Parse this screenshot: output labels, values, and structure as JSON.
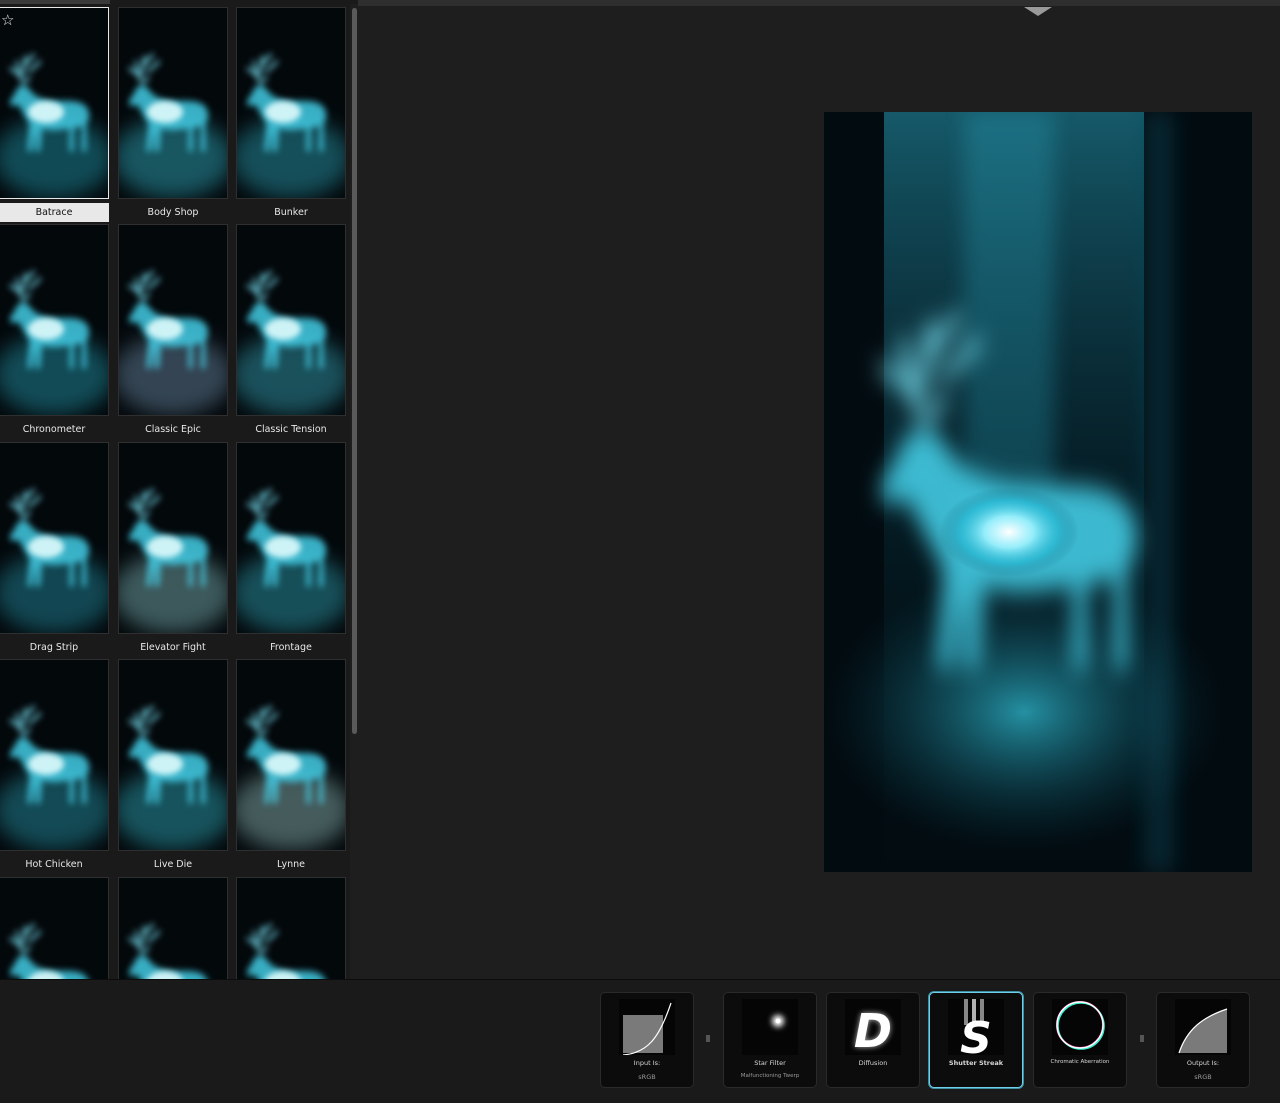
{
  "presets": {
    "favorite_icon": "star-outline-icon",
    "selected": "Batrace",
    "items": [
      {
        "label": "Batrace"
      },
      {
        "label": "Body Shop"
      },
      {
        "label": "Bunker"
      },
      {
        "label": "Chronometer"
      },
      {
        "label": "Classic Epic"
      },
      {
        "label": "Classic Tension"
      },
      {
        "label": "Drag Strip"
      },
      {
        "label": "Elevator Fight"
      },
      {
        "label": "Frontage"
      },
      {
        "label": "Hot Chicken"
      },
      {
        "label": "Live Die"
      },
      {
        "label": "Lynne"
      },
      {
        "label": ""
      },
      {
        "label": ""
      },
      {
        "label": ""
      }
    ]
  },
  "viewer": {
    "collapse_icon": "triangle-down-icon",
    "image_subject": "glowing cyan stag"
  },
  "tool_chain": {
    "input": {
      "title": "Input Is:",
      "value": "sRGB",
      "icon": "curve-icon"
    },
    "tools": [
      {
        "name": "Star Filter",
        "sub": "Malfunctioning Twerp",
        "icon": "star-filter-icon"
      },
      {
        "name": "Diffusion",
        "sub": "",
        "icon": "diffusion-d-icon"
      },
      {
        "name": "Shutter Streak",
        "sub": "",
        "icon": "shutter-streak-s-icon",
        "active": true
      },
      {
        "name": "Chromatic Aberration",
        "sub": "",
        "icon": "ring-icon"
      }
    ],
    "output": {
      "title": "Output Is:",
      "value": "sRGB",
      "icon": "curve-icon"
    }
  },
  "colors": {
    "accent": "#6fd1e8",
    "glow": "#37d9f2",
    "background": "#1c1c1c"
  }
}
